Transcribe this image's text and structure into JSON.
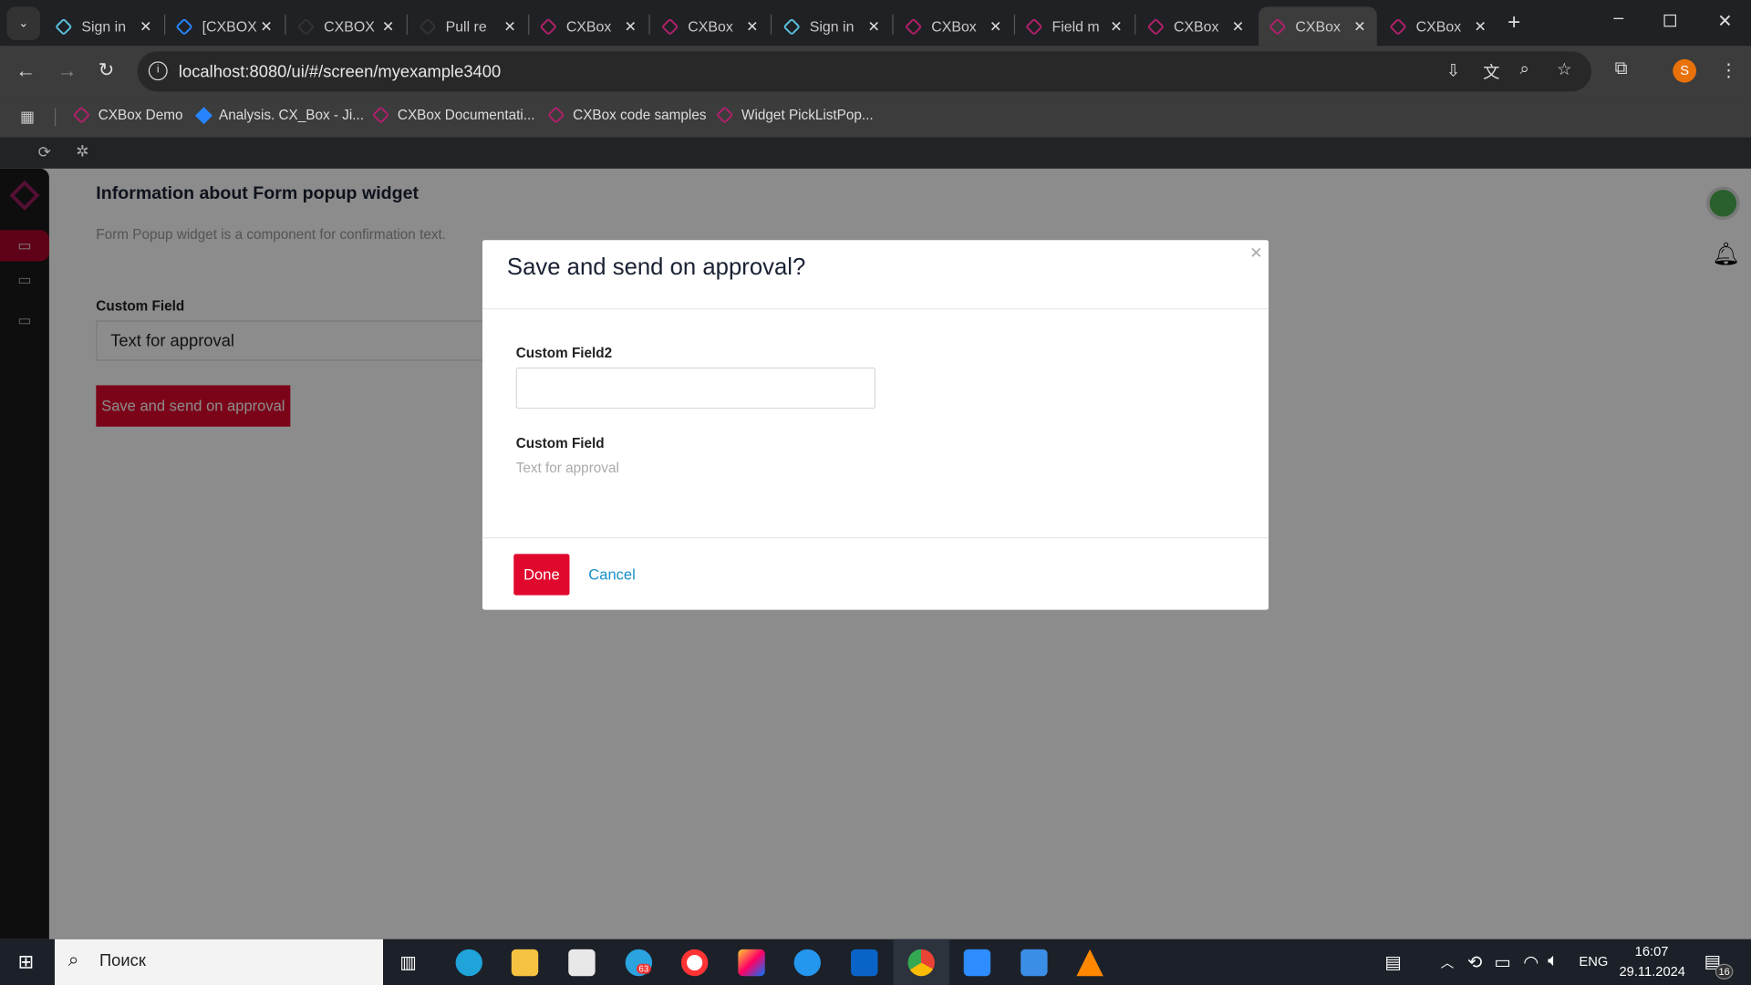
{
  "browser": {
    "tabs": [
      {
        "title": "Sign in",
        "icon": "keycloak-icon"
      },
      {
        "title": "[CXBOX",
        "icon": "jira-icon"
      },
      {
        "title": "CXBOX",
        "icon": "github-icon"
      },
      {
        "title": "Pull re",
        "icon": "github-icon"
      },
      {
        "title": "CXBox",
        "icon": "cxbox-icon"
      },
      {
        "title": "CXBox",
        "icon": "cxbox-icon"
      },
      {
        "title": "Sign in",
        "icon": "keycloak-icon"
      },
      {
        "title": "CXBox",
        "icon": "cxbox-icon"
      },
      {
        "title": "Field m",
        "icon": "cxbox-icon"
      },
      {
        "title": "CXBox",
        "icon": "cxbox-icon"
      },
      {
        "title": "CXBox",
        "icon": "cxbox-icon",
        "active": true
      },
      {
        "title": "CXBox",
        "icon": "cxbox-icon"
      }
    ],
    "url": "localhost:8080/ui/#/screen/myexample3400",
    "profile_initial": "S",
    "bookmarks": [
      "CXBox Demo",
      "Analysis. CX_Box - Ji...",
      "CXBox Documentati...",
      "CXBox code samples",
      "Widget PickListPop..."
    ]
  },
  "page": {
    "title": "Information about Form popup widget",
    "description": "Form Popup widget is a component for confirmation text.",
    "field_label": "Custom Field",
    "field_value": "Text for approval",
    "action_button": "Save and send on approval"
  },
  "modal": {
    "title": "Save and send on approval?",
    "field2_label": "Custom Field2",
    "field2_value": "",
    "field_label": "Custom Field",
    "field_value": "Text for approval",
    "done": "Done",
    "cancel": "Cancel"
  },
  "taskbar": {
    "search_placeholder": "Поиск",
    "telegram_badge": "63",
    "lang": "ENG",
    "time": "16:07",
    "date": "29.11.2024",
    "notifications": "16"
  },
  "colors": {
    "accent": "#e0082d",
    "sidebar_active": "#7a0019",
    "link": "#1890c8"
  }
}
